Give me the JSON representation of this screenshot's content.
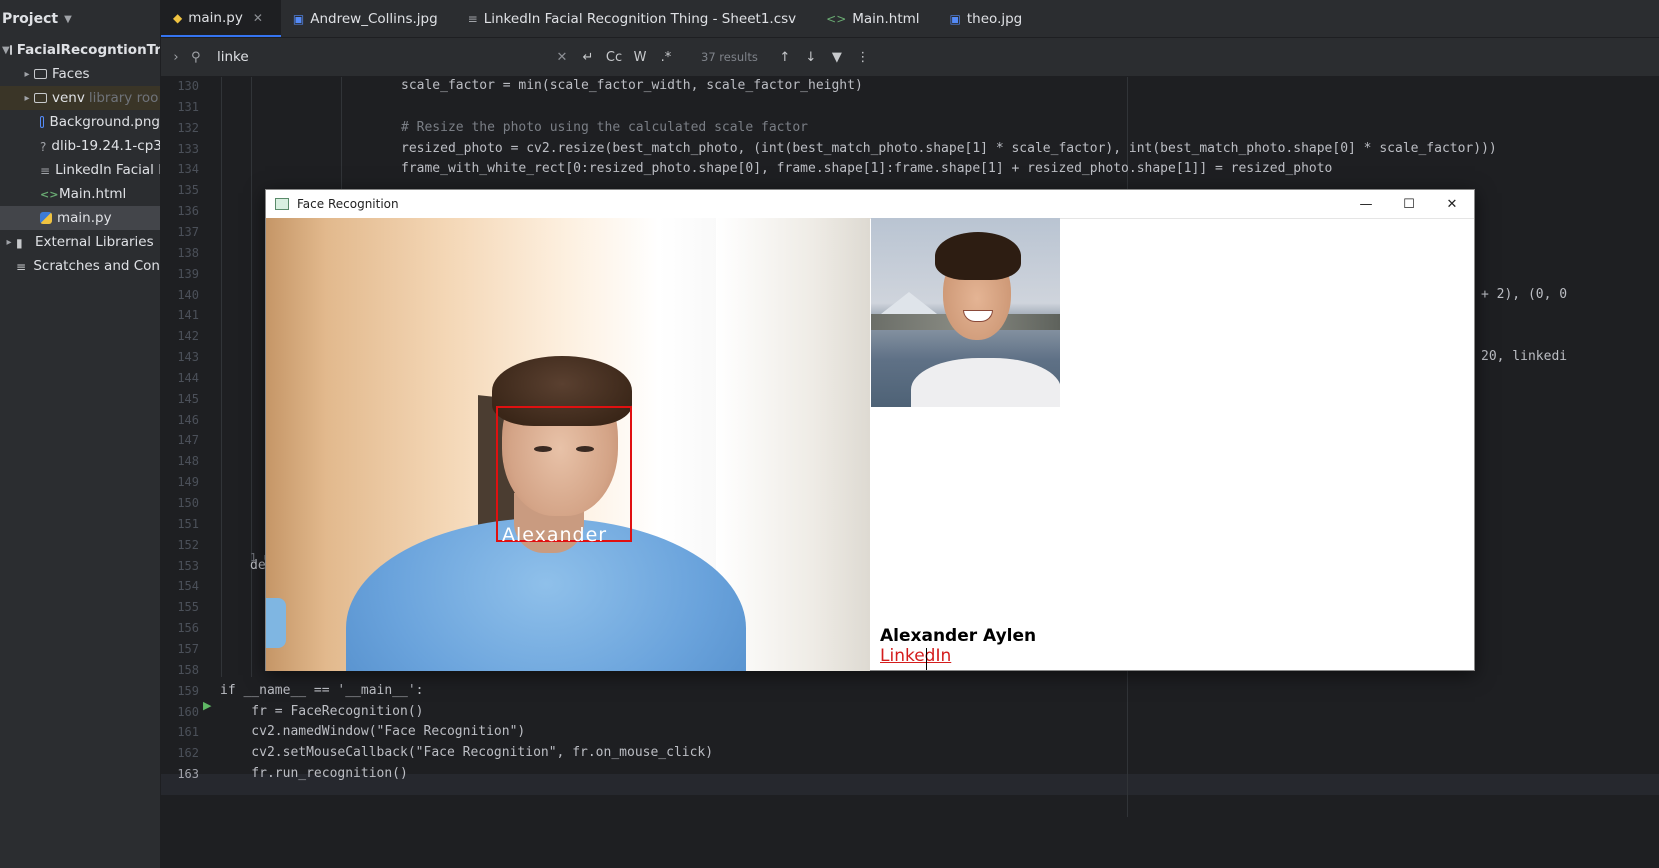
{
  "project": {
    "title": "Project",
    "tree": [
      {
        "label": "FacialRecogntionTr",
        "depth": 0,
        "expanded": true,
        "kind": "folder"
      },
      {
        "label": "Faces",
        "depth": 1,
        "kind": "folder"
      },
      {
        "label": "venv",
        "suffix": "library roo",
        "depth": 1,
        "kind": "folder"
      },
      {
        "label": "Background.png",
        "depth": 1,
        "kind": "image"
      },
      {
        "label": "dlib-19.24.1-cp3",
        "depth": 1,
        "kind": "text"
      },
      {
        "label": "LinkedIn Facial F",
        "depth": 1,
        "kind": "text"
      },
      {
        "label": "Main.html",
        "depth": 1,
        "kind": "html"
      },
      {
        "label": "main.py",
        "depth": 1,
        "kind": "python"
      },
      {
        "label": "External Libraries",
        "depth": 0,
        "kind": "library"
      },
      {
        "label": "Scratches and Con",
        "depth": 0,
        "kind": "scratch"
      }
    ]
  },
  "tabs": [
    {
      "label": "main.py",
      "icon": "python-icon",
      "active": true
    },
    {
      "label": "Andrew_Collins.jpg",
      "icon": "image-icon"
    },
    {
      "label": "LinkedIn Facial Recognition Thing - Sheet1.csv",
      "icon": "csv-icon"
    },
    {
      "label": "Main.html",
      "icon": "html-icon"
    },
    {
      "label": "theo.jpg",
      "icon": "image-icon"
    }
  ],
  "find": {
    "query": "linke",
    "buttons": [
      "Cc",
      "W",
      ".*"
    ],
    "results": "37 results"
  },
  "editor": {
    "current_line": 163,
    "lines": [
      {
        "n": 130,
        "text": "scale_factor = min(scale_factor_width, scale_factor_height)"
      },
      {
        "n": 131,
        "text": ""
      },
      {
        "n": 132,
        "text": "# Resize the photo using the calculated scale factor"
      },
      {
        "n": 133,
        "text": "resized_photo = cv2.resize(best_match_photo, (int(best_match_photo.shape[1] * scale_factor), int(best_match_photo.shape[0] * scale_factor)))"
      },
      {
        "n": 134,
        "text": "frame_with_white_rect[0:resized_photo.shape[0], frame.shape[1]:frame.shape[1] + resized_photo.shape[1]] = resized_photo"
      },
      {
        "n": 135,
        "text": ""
      },
      {
        "n": 136,
        "text": ""
      },
      {
        "n": 137,
        "text": ""
      },
      {
        "n": 138,
        "text": ""
      },
      {
        "n": 139,
        "text": ""
      },
      {
        "n": 140,
        "text": "+ 2), (0, 0"
      },
      {
        "n": 141,
        "text": ""
      },
      {
        "n": 142,
        "text": ""
      },
      {
        "n": 143,
        "text": "20, linkedi"
      },
      {
        "n": 144,
        "text": ""
      },
      {
        "n": 145,
        "text": ""
      },
      {
        "n": 146,
        "text": ""
      },
      {
        "n": 147,
        "text": ""
      },
      {
        "n": 148,
        "text": ""
      },
      {
        "n": 149,
        "text": ""
      },
      {
        "n": 150,
        "text": ""
      },
      {
        "n": 151,
        "text": ""
      },
      {
        "n": 152,
        "text": ""
      },
      {
        "n": 153,
        "text": "de"
      },
      {
        "n": 154,
        "text": ""
      },
      {
        "n": 155,
        "text": ""
      },
      {
        "n": 156,
        "text": ""
      },
      {
        "n": 157,
        "text": ""
      },
      {
        "n": 158,
        "text": ""
      },
      {
        "n": 159,
        "text": "if __name__ == '__main__':"
      },
      {
        "n": 160,
        "text": "    fr = FaceRecognition()"
      },
      {
        "n": 161,
        "text": "    cv2.namedWindow(\"Face Recognition\")"
      },
      {
        "n": 162,
        "text": "    cv2.setMouseCallback(\"Face Recognition\", fr.on_mouse_click)"
      },
      {
        "n": 163,
        "text": "    fr.run_recognition()"
      }
    ],
    "usage_hint": "1 u"
  },
  "window": {
    "title": "Face Recognition",
    "face_label": "Alexander",
    "match_name": "Alexander Aylen",
    "match_link": "LinkedIn"
  },
  "colors": {
    "accent": "#3574f0",
    "face_box": "#e01010",
    "link": "#d41c1c"
  }
}
